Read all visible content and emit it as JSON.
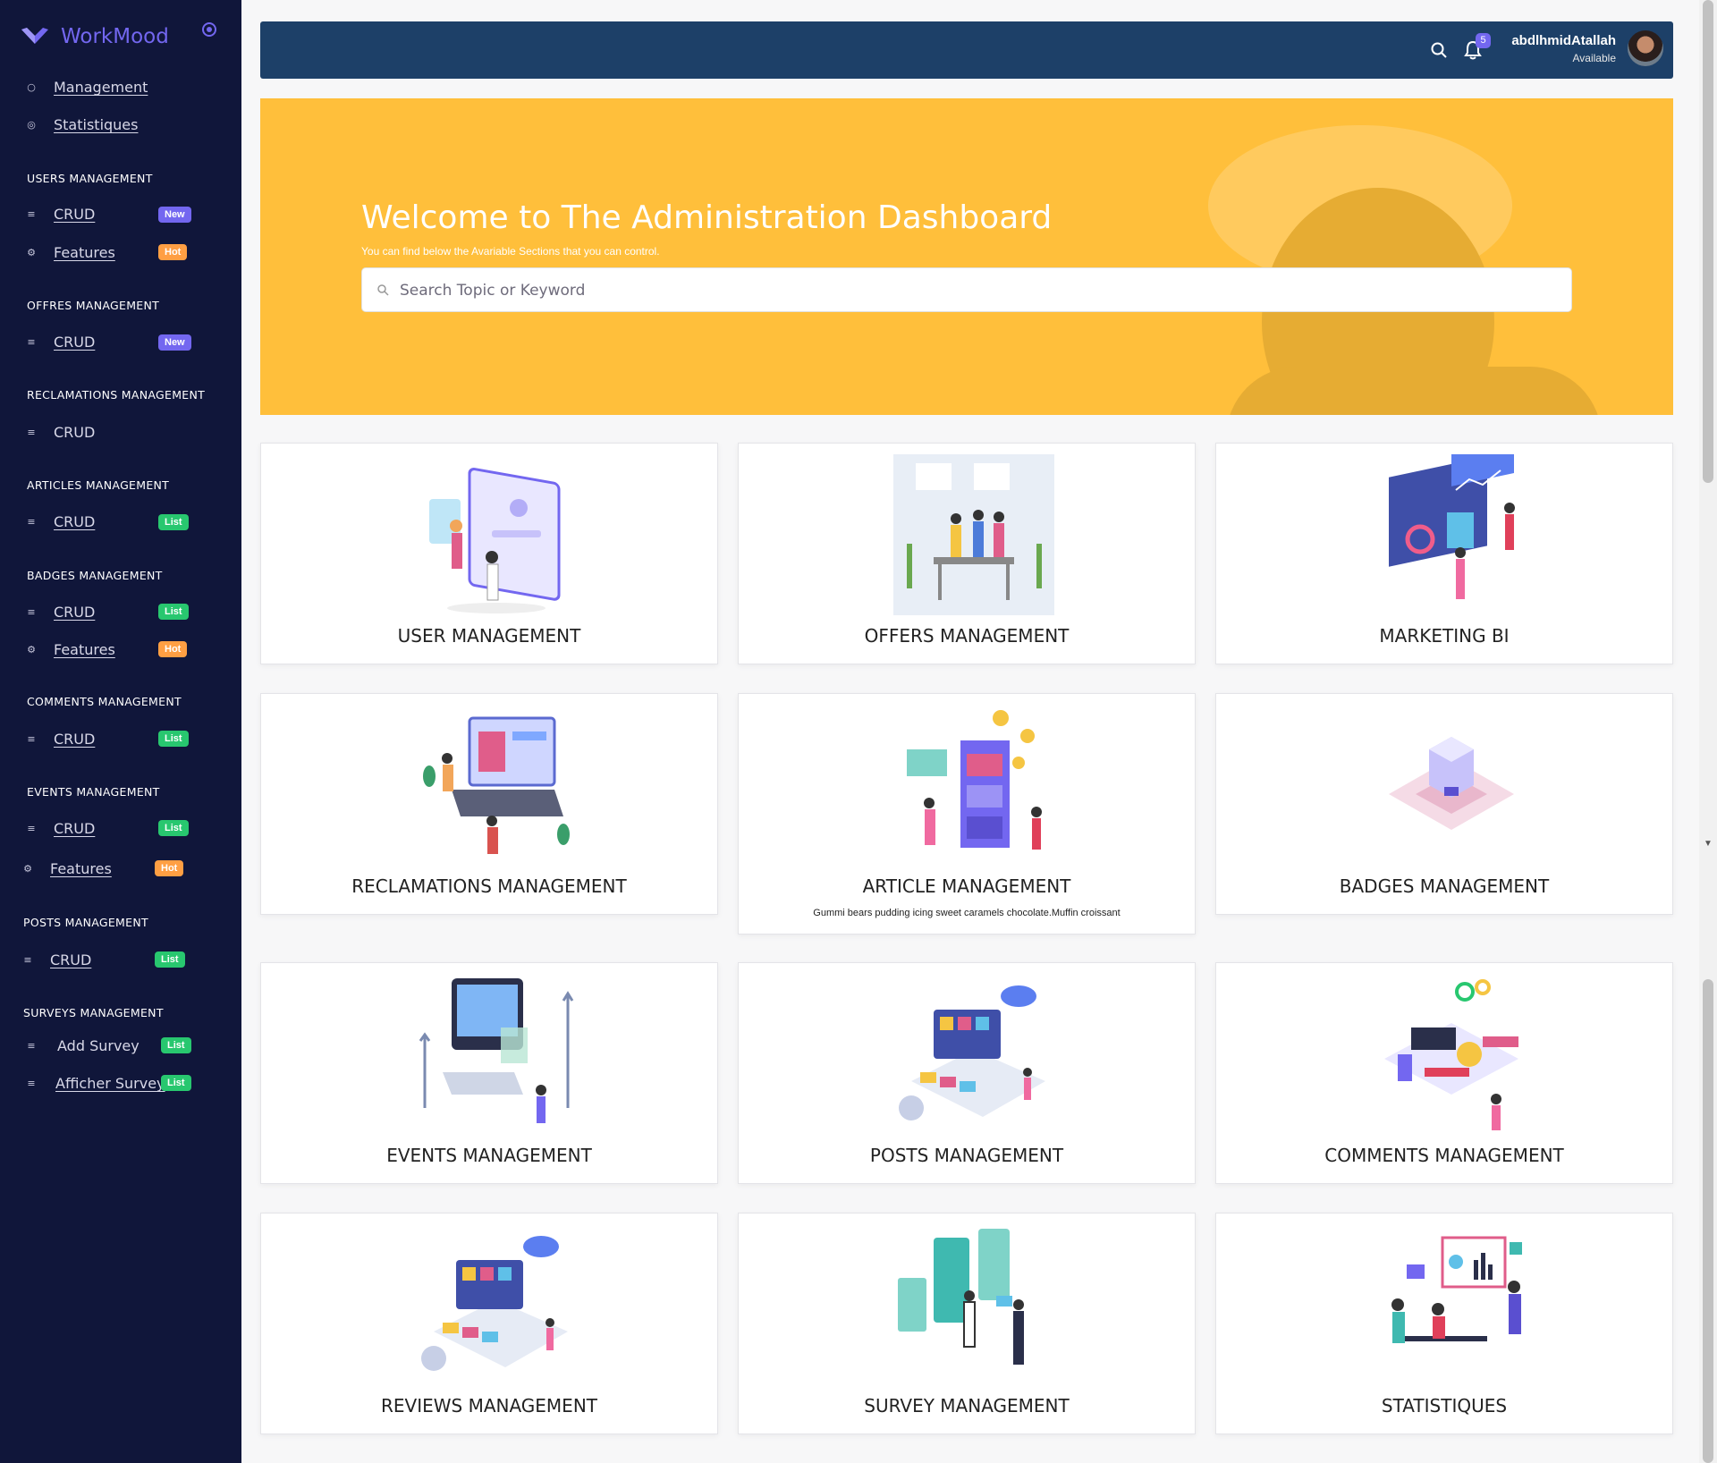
{
  "brand": {
    "name": "WorkMood"
  },
  "sidebar": {
    "top_items": [
      {
        "label": "Management"
      },
      {
        "label": "Statistiques"
      }
    ],
    "sections": [
      {
        "title": "USERS MANAGEMENT",
        "items": [
          {
            "label": "CRUD",
            "badge": "New"
          },
          {
            "label": "Features",
            "badge": "Hot"
          }
        ]
      },
      {
        "title": "OFFRES MANAGEMENT",
        "items": [
          {
            "label": "CRUD",
            "badge": "New"
          }
        ]
      },
      {
        "title": "RECLAMATIONS MANAGEMENT",
        "items": [
          {
            "label": "CRUD"
          }
        ]
      },
      {
        "title": "ARTICLES MANAGEMENT",
        "items": [
          {
            "label": "CRUD",
            "badge": "List"
          }
        ]
      },
      {
        "title": "BADGES MANAGEMENT",
        "items": [
          {
            "label": "CRUD",
            "badge": "List"
          },
          {
            "label": "Features",
            "badge": "Hot"
          }
        ]
      },
      {
        "title": "COMMENTS MANAGEMENT",
        "items": [
          {
            "label": "CRUD",
            "badge": "List"
          }
        ]
      },
      {
        "title": "EVENTS MANAGEMENT",
        "items": [
          {
            "label": "CRUD",
            "badge": "List"
          },
          {
            "label": "Features",
            "badge": "Hot"
          }
        ]
      },
      {
        "title": "POSTS MANAGEMENT",
        "items": [
          {
            "label": "CRUD",
            "badge": "List"
          }
        ]
      },
      {
        "title": "SURVEYS MANAGEMENT",
        "items": [
          {
            "label": "Add Survey",
            "badge": "List"
          },
          {
            "label": "Afficher Survey",
            "badge": "List"
          }
        ]
      }
    ]
  },
  "header": {
    "notifications_count": "5",
    "user_name": "abdlhmidAtallah",
    "user_status": "Available"
  },
  "hero": {
    "title": "Welcome to The Administration Dashboard",
    "subtitle": "You can find below the Avariable Sections that you can control.",
    "search_placeholder": "Search Topic or Keyword"
  },
  "cards": [
    {
      "title": "USER MANAGEMENT",
      "icon": "user-management-illustration"
    },
    {
      "title": "OFFERS MANAGEMENT",
      "icon": "offers-management-illustration"
    },
    {
      "title": "MARKETING BI",
      "icon": "marketing-bi-illustration"
    },
    {
      "title": "RECLAMATIONS MANAGEMENT",
      "icon": "reclamations-illustration"
    },
    {
      "title": "ARTICLE MANAGEMENT",
      "icon": "article-illustration",
      "description": "Gummi bears pudding icing sweet caramels chocolate.Muffin croissant"
    },
    {
      "title": "BADGES MANAGEMENT",
      "icon": "badges-illustration"
    },
    {
      "title": "EVENTS MANAGEMENT",
      "icon": "events-illustration"
    },
    {
      "title": "POSTS MANAGEMENT",
      "icon": "posts-illustration"
    },
    {
      "title": "COMMENTS MANAGEMENT",
      "icon": "comments-illustration"
    },
    {
      "title": "REVIEWS MANAGEMENT",
      "icon": "reviews-illustration"
    },
    {
      "title": "SURVEY MANAGEMENT",
      "icon": "survey-illustration"
    },
    {
      "title": "STATISTIQUES",
      "icon": "statistics-illustration"
    }
  ],
  "colors": {
    "sidebar": "#10163a",
    "accent": "#7367f0",
    "hero": "#ffbf3b",
    "topbar": "#1d4068",
    "new": "#7367f0",
    "hot": "#ff9f43",
    "list": "#28c76f"
  }
}
